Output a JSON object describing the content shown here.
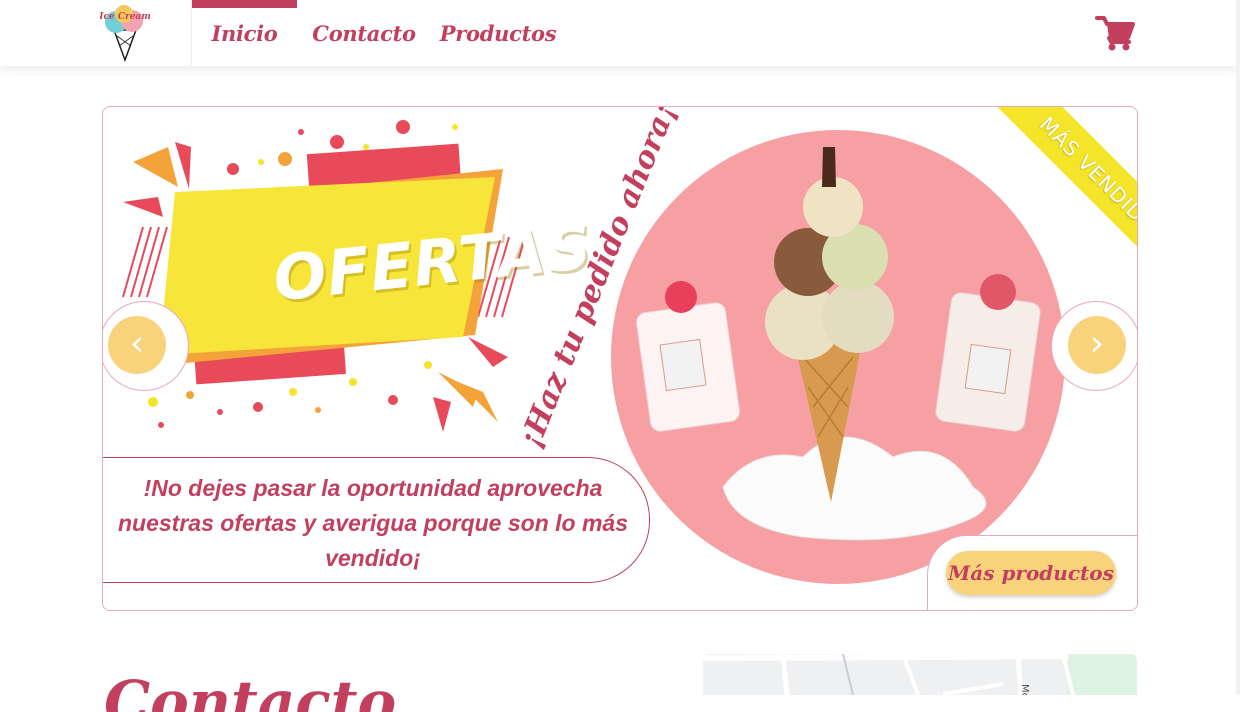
{
  "header": {
    "logo_text": "Ice Cream",
    "nav": [
      {
        "label": "Inicio",
        "active": true
      },
      {
        "label": "Contacto",
        "active": false
      },
      {
        "label": "Productos",
        "active": false
      }
    ]
  },
  "carousel": {
    "headline": "OFERTAS",
    "slogan": "¡Haz tu pedido ahora¡",
    "ribbon": "MÁS VENDIDOS",
    "message": "!No dejes pasar la oportunidad aprovecha nuestras ofertas y averigua porque son lo más vendido¡",
    "more_button": "Más productos",
    "prev_icon": "‹",
    "next_icon": "›"
  },
  "section": {
    "title": "Contacto"
  },
  "map": {
    "street_label": "Mo"
  },
  "colors": {
    "accent": "#c2405e",
    "button": "#f9d27c",
    "ribbon": "#f4e42a",
    "circle": "#f7a0a4"
  }
}
